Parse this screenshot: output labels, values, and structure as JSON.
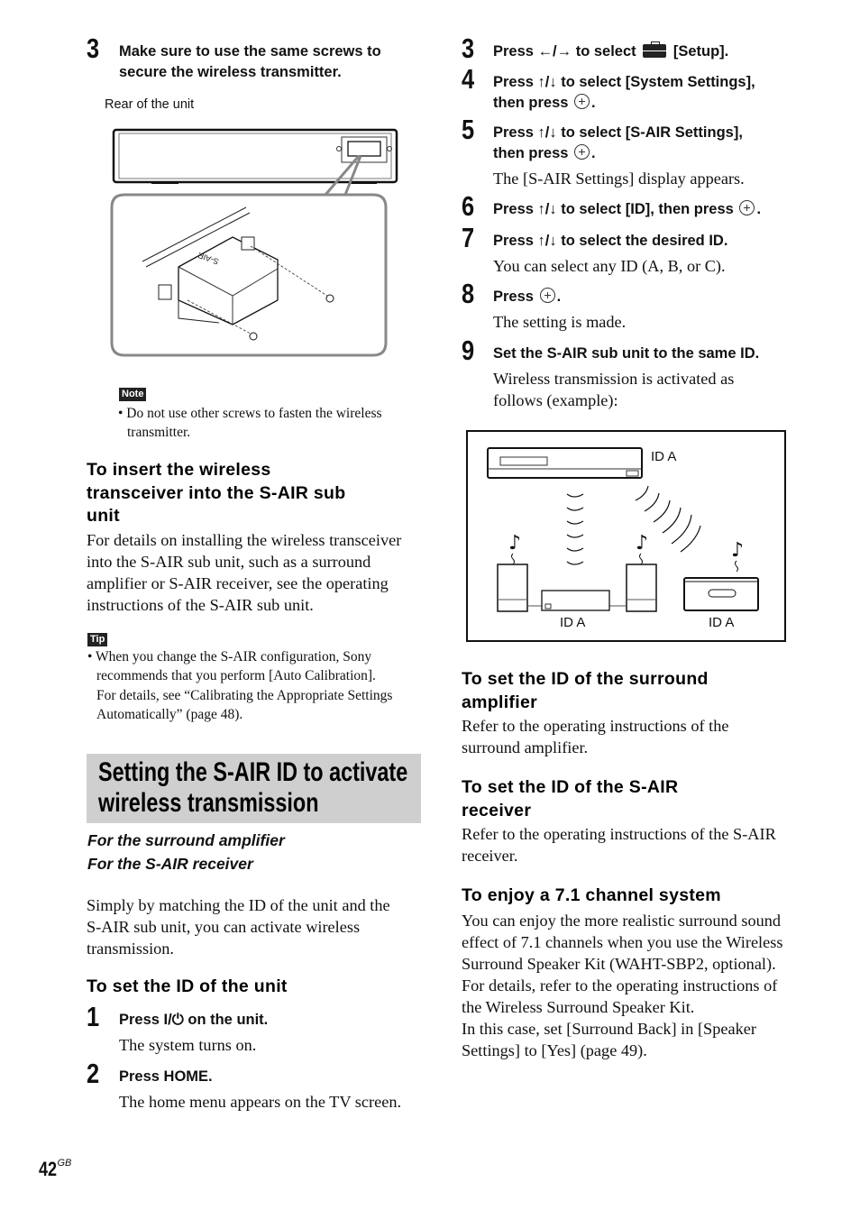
{
  "left_column": {
    "step3": {
      "number": "3",
      "text_line1": "Make sure to use the same screws to",
      "text_line2": "secure the wireless transmitter."
    },
    "figure_caption": "Rear of the unit",
    "figure_label": "S-AIR",
    "note": {
      "tag": "Note",
      "bullet_line1": "• Do not use other screws to fasten the wireless",
      "bullet_line2": "transmitter."
    },
    "insert_heading": {
      "line1": "To insert the wireless",
      "line2": "transceiver into the S-AIR sub",
      "line3": "unit"
    },
    "insert_body": [
      "For details on installing the wireless transceiver",
      "into the S-AIR sub unit, such as a surround",
      "amplifier or S-AIR receiver, see the operating",
      "instructions of the S-AIR sub unit."
    ],
    "tip": {
      "tag": "Tip",
      "lines": [
        "• When you change the S-AIR configuration, Sony",
        "recommends that you perform [Auto Calibration].",
        "For details, see “Calibrating the Appropriate Settings",
        "Automatically” (page 48)."
      ]
    },
    "section_banner": {
      "line1": "Setting the S-AIR ID to activate",
      "line2": "wireless transmission"
    },
    "applies_to": [
      "For the surround amplifier",
      "For the S-AIR receiver"
    ],
    "intro": [
      "Simply by matching the ID of the unit and the",
      "S-AIR sub unit, you can activate wireless",
      "transmission."
    ],
    "unit_heading": "To set the ID of the unit",
    "step1": {
      "number": "1",
      "text_pre": "Press ",
      "text_sym": "I/⏻",
      "text_post": " on the unit.",
      "result": "The system turns on."
    },
    "step2": {
      "number": "2",
      "text": "Press HOME.",
      "result": "The home menu appears on the TV screen."
    },
    "page_number": "42",
    "page_suffix": "GB"
  },
  "right_column": {
    "step3": {
      "number": "3",
      "pre": "Press ←/→ to select",
      "post": "[Setup]."
    },
    "step4": {
      "number": "4",
      "line1": "Press ↑/↓ to select [System Settings],",
      "line2_pre": "then press",
      "line2_post": "."
    },
    "step5": {
      "number": "5",
      "line1": "Press ↑/↓ to select [S-AIR Settings],",
      "line2_pre": "then press",
      "line2_post": ".",
      "result": "The [S-AIR Settings] display appears."
    },
    "step6": {
      "number": "6",
      "pre": "Press ↑/↓ to select [ID], then press",
      "post": "."
    },
    "step7": {
      "number": "7",
      "text": "Press ↑/↓ to select the desired ID.",
      "result": "You can select any ID (A, B, or C)."
    },
    "step8": {
      "number": "8",
      "pre": "Press",
      "post": ".",
      "result": "The setting is made."
    },
    "step9": {
      "number": "9",
      "text": "Set the S-AIR sub unit to the same ID.",
      "result_line1": "Wireless transmission is activated as",
      "result_line2": "follows (example):"
    },
    "diagram": {
      "main_unit_label": "ID A",
      "amplifier_label": "ID A",
      "receiver_label": "ID A"
    },
    "amp_heading": {
      "line1": "To set the ID of the surround",
      "line2": "amplifier"
    },
    "amp_body": [
      "Refer to the operating instructions of the",
      "surround amplifier."
    ],
    "receiver_heading": {
      "line1": "To set the ID of the S-AIR",
      "line2": "receiver"
    },
    "receiver_body": [
      "Refer to the operating instructions of the S-AIR",
      "receiver."
    ],
    "enjoy_heading": "To enjoy a 7.1 channel system",
    "enjoy_body": [
      "You can enjoy the more realistic surround sound",
      "effect of 7.1 channels when you use the Wireless",
      "Surround Speaker Kit (WAHT-SBP2, optional).",
      "For details, refer to the operating instructions of",
      "the Wireless Surround Speaker Kit.",
      "In this case, set [Surround Back] in [Speaker",
      "Settings] to [Yes] (page 49)."
    ]
  }
}
